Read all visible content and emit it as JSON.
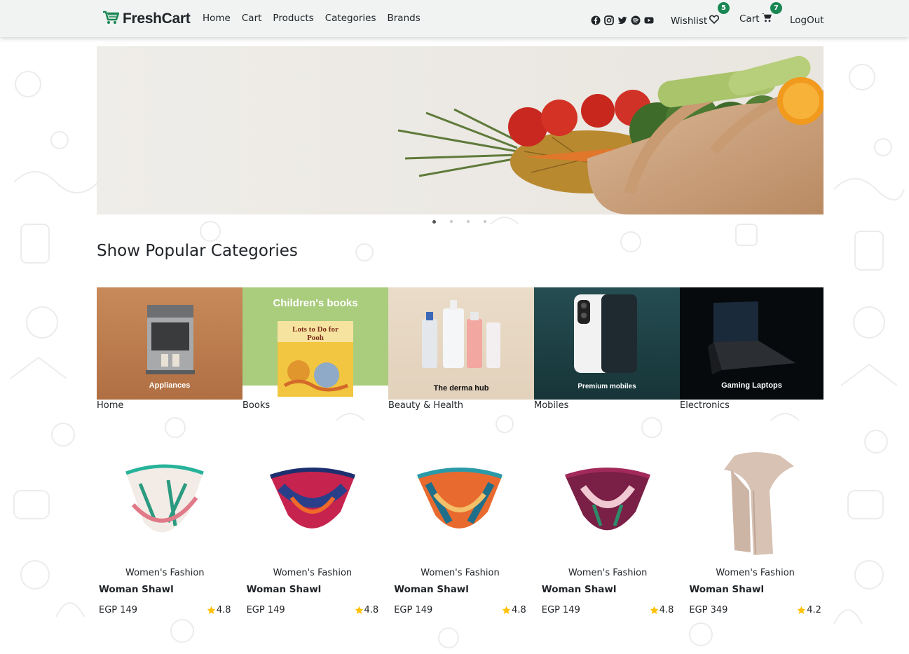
{
  "brand": {
    "name": "FreshCart"
  },
  "nav": {
    "links": [
      "Home",
      "Cart",
      "Products",
      "Categories",
      "Brands"
    ],
    "social_icons": [
      "facebook-icon",
      "instagram-icon",
      "twitter-icon",
      "spotify-icon",
      "youtube-icon"
    ],
    "wishlist_label": "Wishlist",
    "wishlist_count": "5",
    "cart_label": "Cart",
    "cart_count": "7",
    "logout_label": "LogOut"
  },
  "slider": {
    "slide_count": 4,
    "active_index": 0
  },
  "categories_title": "Show Popular Categories",
  "categories": [
    {
      "name": "Home",
      "caption": "Appliances"
    },
    {
      "name": "Books",
      "caption": "Children's books",
      "book_title": "Lots to Do for Pooh"
    },
    {
      "name": "Beauty & Health",
      "caption": "The derma hub"
    },
    {
      "name": "Mobiles",
      "caption": "Premium mobiles"
    },
    {
      "name": "Electronics",
      "caption": "Gaming Laptops"
    }
  ],
  "products": [
    {
      "category": "Women's Fashion",
      "title": "Woman Shawl",
      "price": "EGP 149",
      "rating": "4.8"
    },
    {
      "category": "Women's Fashion",
      "title": "Woman Shawl",
      "price": "EGP 149",
      "rating": "4.8"
    },
    {
      "category": "Women's Fashion",
      "title": "Woman Shawl",
      "price": "EGP 149",
      "rating": "4.8"
    },
    {
      "category": "Women's Fashion",
      "title": "Woman Shawl",
      "price": "EGP 149",
      "rating": "4.8"
    },
    {
      "category": "Women's Fashion",
      "title": "Woman Shawl",
      "price": "EGP 349",
      "rating": "4.2"
    }
  ],
  "colors": {
    "accent": "#198754",
    "navbar_bg": "#f0f3f2",
    "star": "#ffc107"
  }
}
